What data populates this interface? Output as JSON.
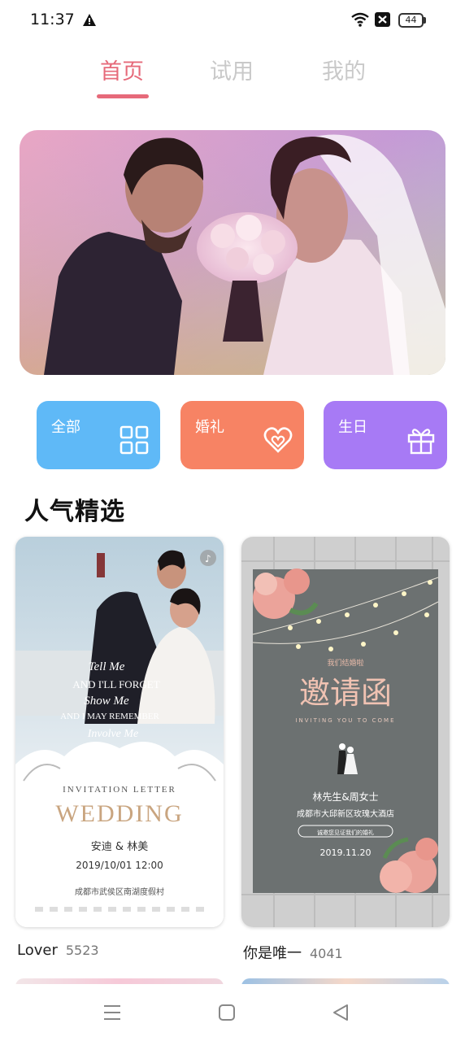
{
  "status_bar": {
    "time": "11:37",
    "battery": "44",
    "icons": [
      "warning-icon",
      "wifi-icon",
      "sim-blocked-icon",
      "battery-icon"
    ]
  },
  "tabs": [
    {
      "label": "首页",
      "active": true
    },
    {
      "label": "试用",
      "active": false
    },
    {
      "label": "我的",
      "active": false
    }
  ],
  "colors": {
    "accent": "#e66a7a",
    "cat_all": "#5fb9f7",
    "cat_wedding": "#f78364",
    "cat_birthday": "#a77af5"
  },
  "categories": [
    {
      "label": "全部",
      "icon": "grid-icon"
    },
    {
      "label": "婚礼",
      "icon": "heart-icon"
    },
    {
      "label": "生日",
      "icon": "gift-icon"
    }
  ],
  "section_title": "人气精选",
  "cards": [
    {
      "name": "Lover",
      "count": "5523",
      "lines": [
        "Tell Me",
        "AND I'LL FORGET",
        "Show Me",
        "AND I MAY REMEMBER",
        "Involve Me",
        "INVITATION LETTER",
        "WEDDING",
        "安迪 & 林美",
        "2019/10/01 12:00",
        "成都市武侯区南湖度假村"
      ]
    },
    {
      "name": "你是唯一",
      "count": "4041",
      "lines": [
        "我们结婚啦",
        "邀请函",
        "INVITING YOU TO COME",
        "林先生&周女士",
        "成都市大邱新区玫瑰大酒店",
        "诚邀您见证我们的婚礼",
        "2019.11.20"
      ]
    }
  ],
  "nav": [
    "menu-icon",
    "home-icon",
    "back-icon"
  ]
}
